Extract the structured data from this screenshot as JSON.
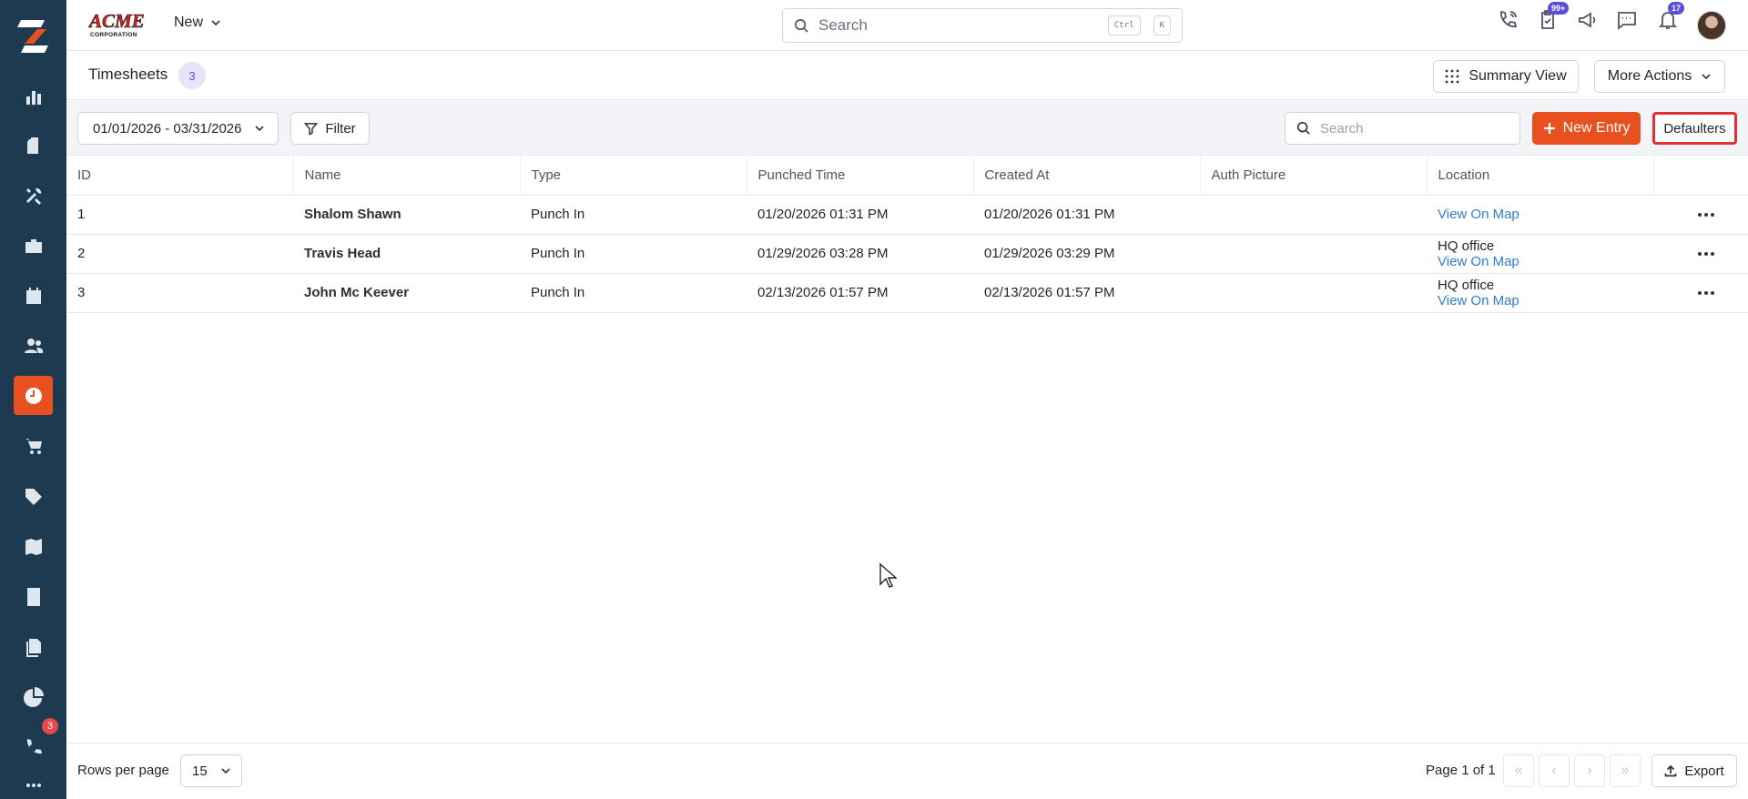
{
  "brand": {
    "name": "ACME CORPORATION"
  },
  "topbar": {
    "new_label": "New",
    "search_placeholder": "Search",
    "shortcut_keys": [
      "Ctrl",
      "K"
    ],
    "badges": {
      "tasks": "99+",
      "notifications": "17"
    }
  },
  "sidebar": {
    "items": [
      {
        "icon": "bar-chart-icon"
      },
      {
        "icon": "clipboard-icon"
      },
      {
        "icon": "tools-icon"
      },
      {
        "icon": "briefcase-icon"
      },
      {
        "icon": "calendar-icon"
      },
      {
        "icon": "users-icon"
      },
      {
        "icon": "clock-icon",
        "active": true
      },
      {
        "icon": "cart-icon"
      },
      {
        "icon": "tag-icon"
      },
      {
        "icon": "map-icon"
      },
      {
        "icon": "calculator-icon"
      },
      {
        "icon": "documents-icon"
      },
      {
        "icon": "pie-chart-icon"
      },
      {
        "icon": "phone-icon",
        "badge": "3"
      }
    ],
    "accent": "#e8501f",
    "background": "#1d3a50"
  },
  "header": {
    "title": "Timesheets",
    "count": "3",
    "summary_view_label": "Summary View",
    "more_actions_label": "More Actions"
  },
  "toolbar": {
    "date_range": "01/01/2026 - 03/31/2026",
    "filter_label": "Filter",
    "search_placeholder": "Search",
    "new_entry_label": "New Entry",
    "defaulters_label": "Defaulters"
  },
  "table": {
    "columns": [
      "ID",
      "Name",
      "Type",
      "Punched Time",
      "Created At",
      "Auth Picture",
      "Location"
    ],
    "rows": [
      {
        "id": "1",
        "name": "Shalom Shawn",
        "type": "Punch In",
        "punched_time": "01/20/2026 01:31 PM",
        "created_at": "01/20/2026 01:31 PM",
        "auth_picture": "",
        "location_text": "",
        "location_link": "View On Map"
      },
      {
        "id": "2",
        "name": "Travis Head",
        "type": "Punch In",
        "punched_time": "01/29/2026 03:28 PM",
        "created_at": "01/29/2026 03:29 PM",
        "auth_picture": "",
        "location_text": "HQ office",
        "location_link": "View On Map"
      },
      {
        "id": "3",
        "name": "John Mc Keever",
        "type": "Punch In",
        "punched_time": "02/13/2026 01:57 PM",
        "created_at": "02/13/2026 01:57 PM",
        "auth_picture": "",
        "location_text": "HQ office",
        "location_link": "View On Map"
      }
    ]
  },
  "footer": {
    "rows_per_page_label": "Rows per page",
    "rows_per_page_value": "15",
    "page_info": "Page 1 of 1",
    "export_label": "Export"
  }
}
